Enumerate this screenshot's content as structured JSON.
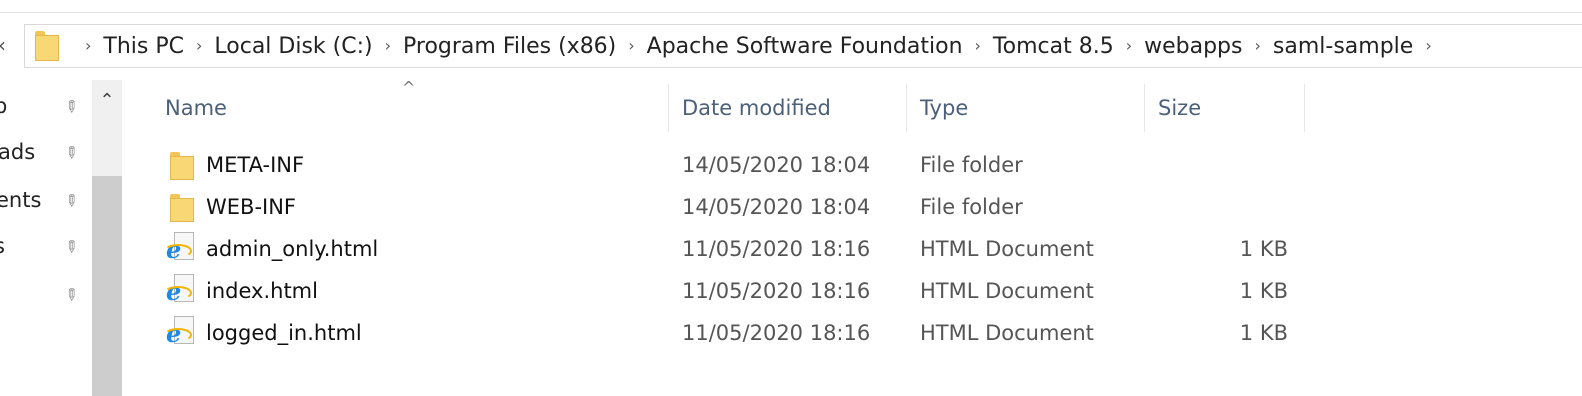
{
  "breadcrumb": [
    "This PC",
    "Local Disk (C:)",
    "Program Files (x86)",
    "Apache Software Foundation",
    "Tomcat 8.5",
    "webapps",
    "saml-sample"
  ],
  "nav_items": [
    {
      "label": "p"
    },
    {
      "label": "ads"
    },
    {
      "label": "ents"
    },
    {
      "label": "s"
    },
    {
      "label": ""
    }
  ],
  "columns": {
    "name": "Name",
    "date": "Date modified",
    "type": "Type",
    "size": "Size"
  },
  "files": [
    {
      "name": "META-INF",
      "date": "14/05/2020 18:04",
      "type": "File folder",
      "size": "",
      "icon": "folder-icon"
    },
    {
      "name": "WEB-INF",
      "date": "14/05/2020 18:04",
      "type": "File folder",
      "size": "",
      "icon": "folder-icon"
    },
    {
      "name": "admin_only.html",
      "date": "11/05/2020 18:16",
      "type": "HTML Document",
      "size": "1 KB",
      "icon": "html-document-icon"
    },
    {
      "name": "index.html",
      "date": "11/05/2020 18:16",
      "type": "HTML Document",
      "size": "1 KB",
      "icon": "html-document-icon"
    },
    {
      "name": "logged_in.html",
      "date": "11/05/2020 18:16",
      "type": "HTML Document",
      "size": "1 KB",
      "icon": "html-document-icon"
    }
  ],
  "colors": {
    "folder": "#f8d775",
    "header_text": "#4c607a",
    "ie_blue": "#1e88e5"
  }
}
